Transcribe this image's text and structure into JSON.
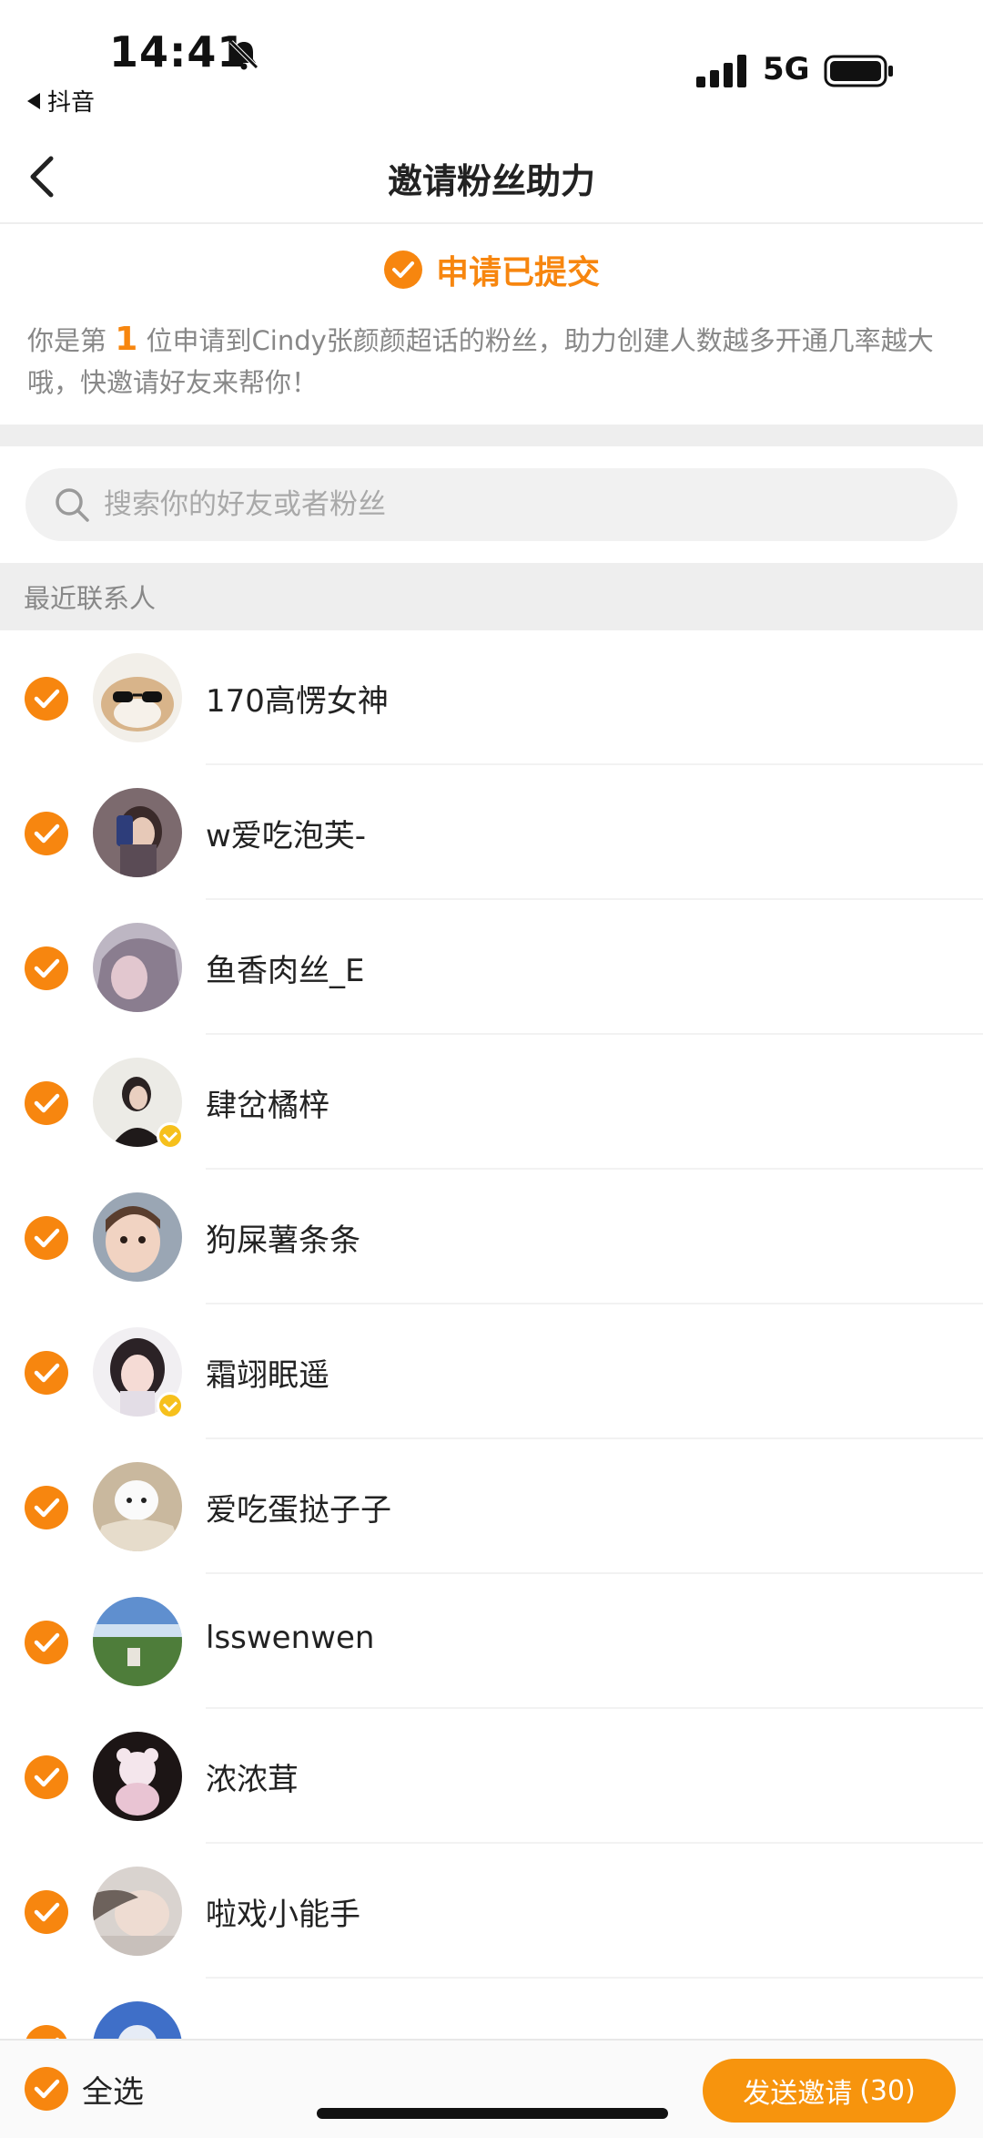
{
  "status": {
    "time": "14:41",
    "back_app": "抖音",
    "network": "5G"
  },
  "nav": {
    "title": "邀请粉丝助力"
  },
  "submitted": {
    "text": "申请已提交",
    "desc_prefix": "你是第",
    "rank": "1",
    "desc_suffix": "位申请到Cindy张颜颜超话的粉丝，助力创建人数越多开通几率越大哦，快邀请好友来帮你！"
  },
  "search": {
    "placeholder": "搜索你的好友或者粉丝"
  },
  "section": {
    "title": "最近联系人"
  },
  "contacts": [
    {
      "name": "170高愣女神",
      "checked": true
    },
    {
      "name": "w爱吃泡芙-",
      "checked": true
    },
    {
      "name": "鱼香肉丝_E",
      "checked": true
    },
    {
      "name": "肆岔橘梓",
      "checked": true
    },
    {
      "name": "狗屎薯条条",
      "checked": true
    },
    {
      "name": "霜翊眠遥",
      "checked": true
    },
    {
      "name": "爱吃蛋挞子子",
      "checked": true
    },
    {
      "name": "lsswenwen",
      "checked": true
    },
    {
      "name": "浓浓茸",
      "checked": true
    },
    {
      "name": "啦戏小能手",
      "checked": true
    }
  ],
  "bottom": {
    "select_all": "全选",
    "send_label": "发送邀请",
    "send_count": "(30)"
  },
  "colors": {
    "accent": "#f7860f",
    "button": "#f7940d",
    "verified": "#f6c01c"
  }
}
